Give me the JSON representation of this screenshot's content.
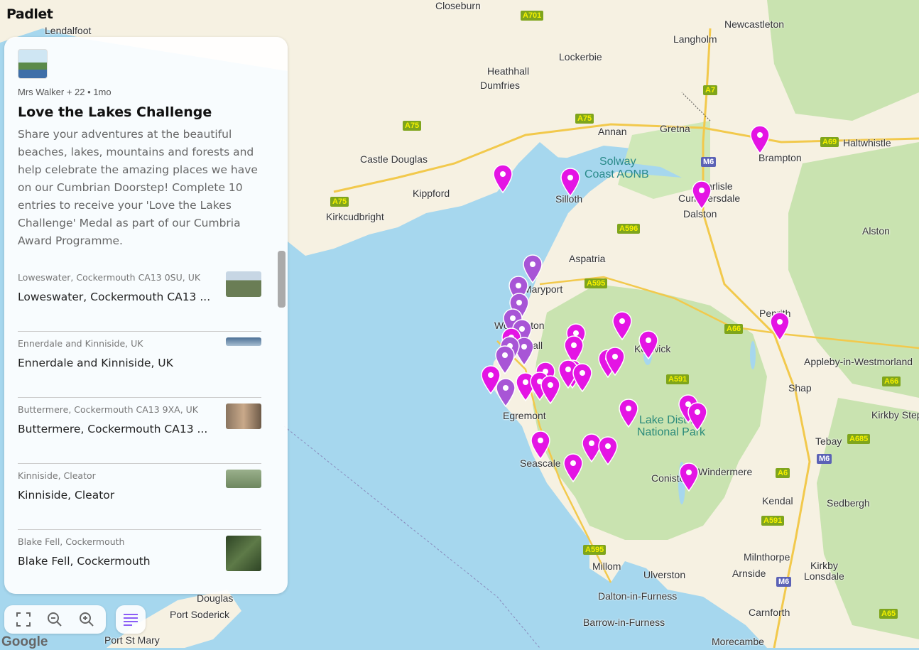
{
  "brand": "Padlet",
  "map_attribution": "Google",
  "colors": {
    "pin_magenta": "#e414e4",
    "pin_purple": "#a855d6",
    "water": "#a6d7ee",
    "land": "#f6f1e2",
    "park": "#c9e3b0"
  },
  "map_labels": {
    "lendalfoot": "Lendalfoot",
    "closeburn": "Closeburn",
    "newcastleton": "Newcastleton",
    "langholm": "Langholm",
    "lockerbie": "Lockerbie",
    "heathhall": "Heathhall",
    "dumfries": "Dumfries",
    "annan": "Annan",
    "gretna": "Gretna",
    "brampton": "Brampton",
    "haltwhistle": "Haltwhistle",
    "castle_douglas": "Castle Douglas",
    "solway": "Solway",
    "coast_aonb": "Coast AONB",
    "carlisle": "Carlisle",
    "cummersdale": "Cummersdale",
    "kippford": "Kippford",
    "silloth": "Silloth",
    "dalston": "Dalston",
    "kirkcudbright": "Kirkcudbright",
    "alston": "Alston",
    "aspatria": "Aspatria",
    "maryport": "Maryport",
    "workington": "Workington",
    "penrith": "Penrith",
    "keswick": "Keswick",
    "appleby": "Appleby-in-Westmorland",
    "shap": "Shap",
    "egremont": "Egremont",
    "lake_district_1": "Lake District",
    "lake_district_2": "National Park",
    "seascale": "Seascale",
    "kirkby_stephen": "Kirkby Stephen",
    "tebay": "Tebay",
    "coniston": "Coniston",
    "windermere": "Windermere",
    "kendal": "Kendal",
    "sedbergh": "Sedbergh",
    "millom": "Millom",
    "ulverston": "Ulverston",
    "milnthorpe": "Milnthorpe",
    "arnside": "Arnside",
    "kirkby_lonsdale_1": "Kirkby",
    "kirkby_lonsdale_2": "Lonsdale",
    "dalton": "Dalton-in-Furness",
    "douglas": "Douglas",
    "port_soderick": "Port Soderick",
    "barrow": "Barrow-in-Furness",
    "carnforth": "Carnforth",
    "port_st_mary": "Port St Mary",
    "morecambe": "Morecambe",
    "hall": "Hall"
  },
  "roads": {
    "a701": "A701",
    "a7": "A7",
    "a75a": "A75",
    "a75b": "A75",
    "a75c": "A75",
    "m6a": "M6",
    "a69": "A69",
    "a596": "A596",
    "a595a": "A595",
    "a66a": "A66",
    "a591a": "A591",
    "a66b": "A66",
    "a685": "A685",
    "m6b": "M6",
    "a6": "A6",
    "a591b": "A591",
    "a595b": "A595",
    "m6c": "M6",
    "a65": "A65"
  },
  "panel": {
    "meta": "Mrs Walker + 22 • 1mo",
    "title": "Love the Lakes Challenge",
    "description": "Share your adventures at the beautiful beaches, lakes, mountains and forests and help celebrate the amazing places we have on our Cumbrian Doorstep! Complete 10 entries to receive your 'Love the Lakes Challenge' Medal as part of our Cumbria Award Programme.",
    "posts": [
      {
        "subtitle": "Loweswater, Cockermouth CA13 0SU, UK",
        "name": "Loweswater, Cockermouth CA13 ...",
        "thumb_color": "#6a7d55"
      },
      {
        "subtitle": "Ennerdale and Kinniside, UK",
        "name": "Ennerdale and Kinniside, UK",
        "thumb_color": "#4a6f95"
      },
      {
        "subtitle": "Buttermere, Cockermouth CA13 9XA, UK",
        "name": "Buttermere, Cockermouth CA13 ...",
        "thumb_color": "#8a7560"
      },
      {
        "subtitle": "Kinniside, Cleator",
        "name": "Kinniside, Cleator",
        "thumb_color": "#7f9a73"
      },
      {
        "subtitle": "Blake Fell, Cockermouth",
        "name": "Blake Fell, Cockermouth",
        "thumb_color": "#3f5a35"
      }
    ]
  },
  "toolbar": {
    "fullscreen": "fullscreen-icon",
    "zoom_out": "zoom-out-icon",
    "zoom_in": "zoom-in-icon",
    "list": "list-icon"
  }
}
